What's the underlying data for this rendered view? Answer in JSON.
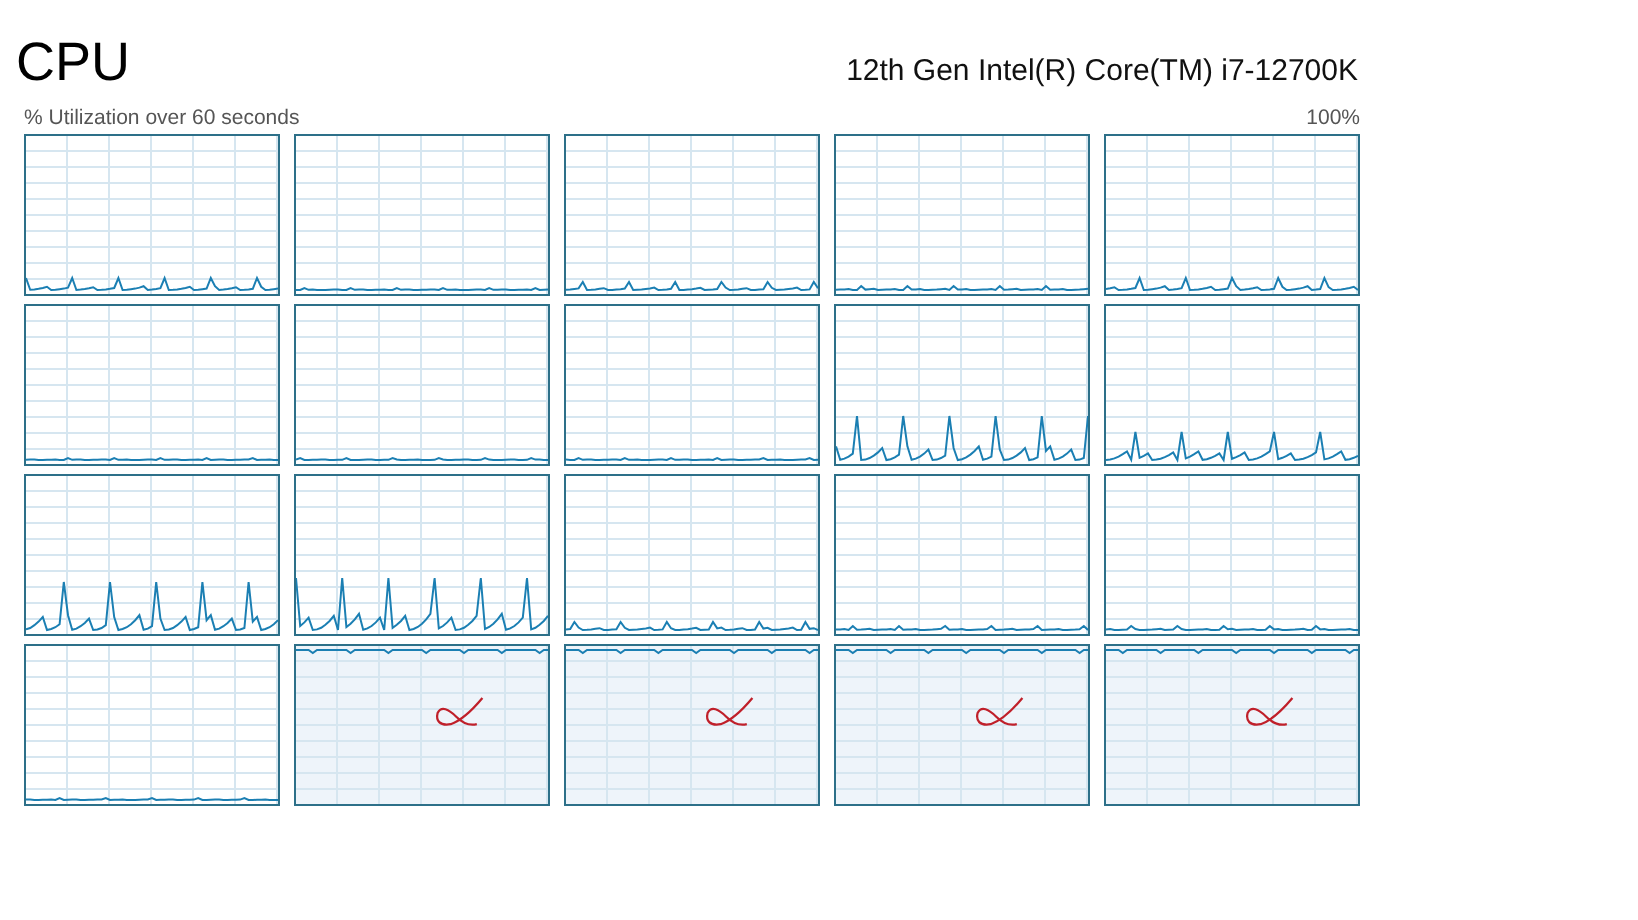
{
  "title": "CPU",
  "processor": "12th Gen Intel(R) Core(TM) i7-12700K",
  "graph_caption": "% Utilization over 60 seconds",
  "graph_max": "100%",
  "cores": [
    {
      "parked": false,
      "annotated": false
    },
    {
      "parked": false,
      "annotated": false
    },
    {
      "parked": false,
      "annotated": false
    },
    {
      "parked": false,
      "annotated": false
    },
    {
      "parked": false,
      "annotated": false
    },
    {
      "parked": false,
      "annotated": false
    },
    {
      "parked": false,
      "annotated": false
    },
    {
      "parked": false,
      "annotated": false
    },
    {
      "parked": false,
      "annotated": false
    },
    {
      "parked": false,
      "annotated": false
    },
    {
      "parked": false,
      "annotated": false
    },
    {
      "parked": false,
      "annotated": false
    },
    {
      "parked": false,
      "annotated": false
    },
    {
      "parked": false,
      "annotated": false
    },
    {
      "parked": false,
      "annotated": false
    },
    {
      "parked": false,
      "annotated": false
    },
    {
      "parked": true,
      "annotated": true
    },
    {
      "parked": true,
      "annotated": true
    },
    {
      "parked": true,
      "annotated": true
    },
    {
      "parked": true,
      "annotated": true
    }
  ]
}
